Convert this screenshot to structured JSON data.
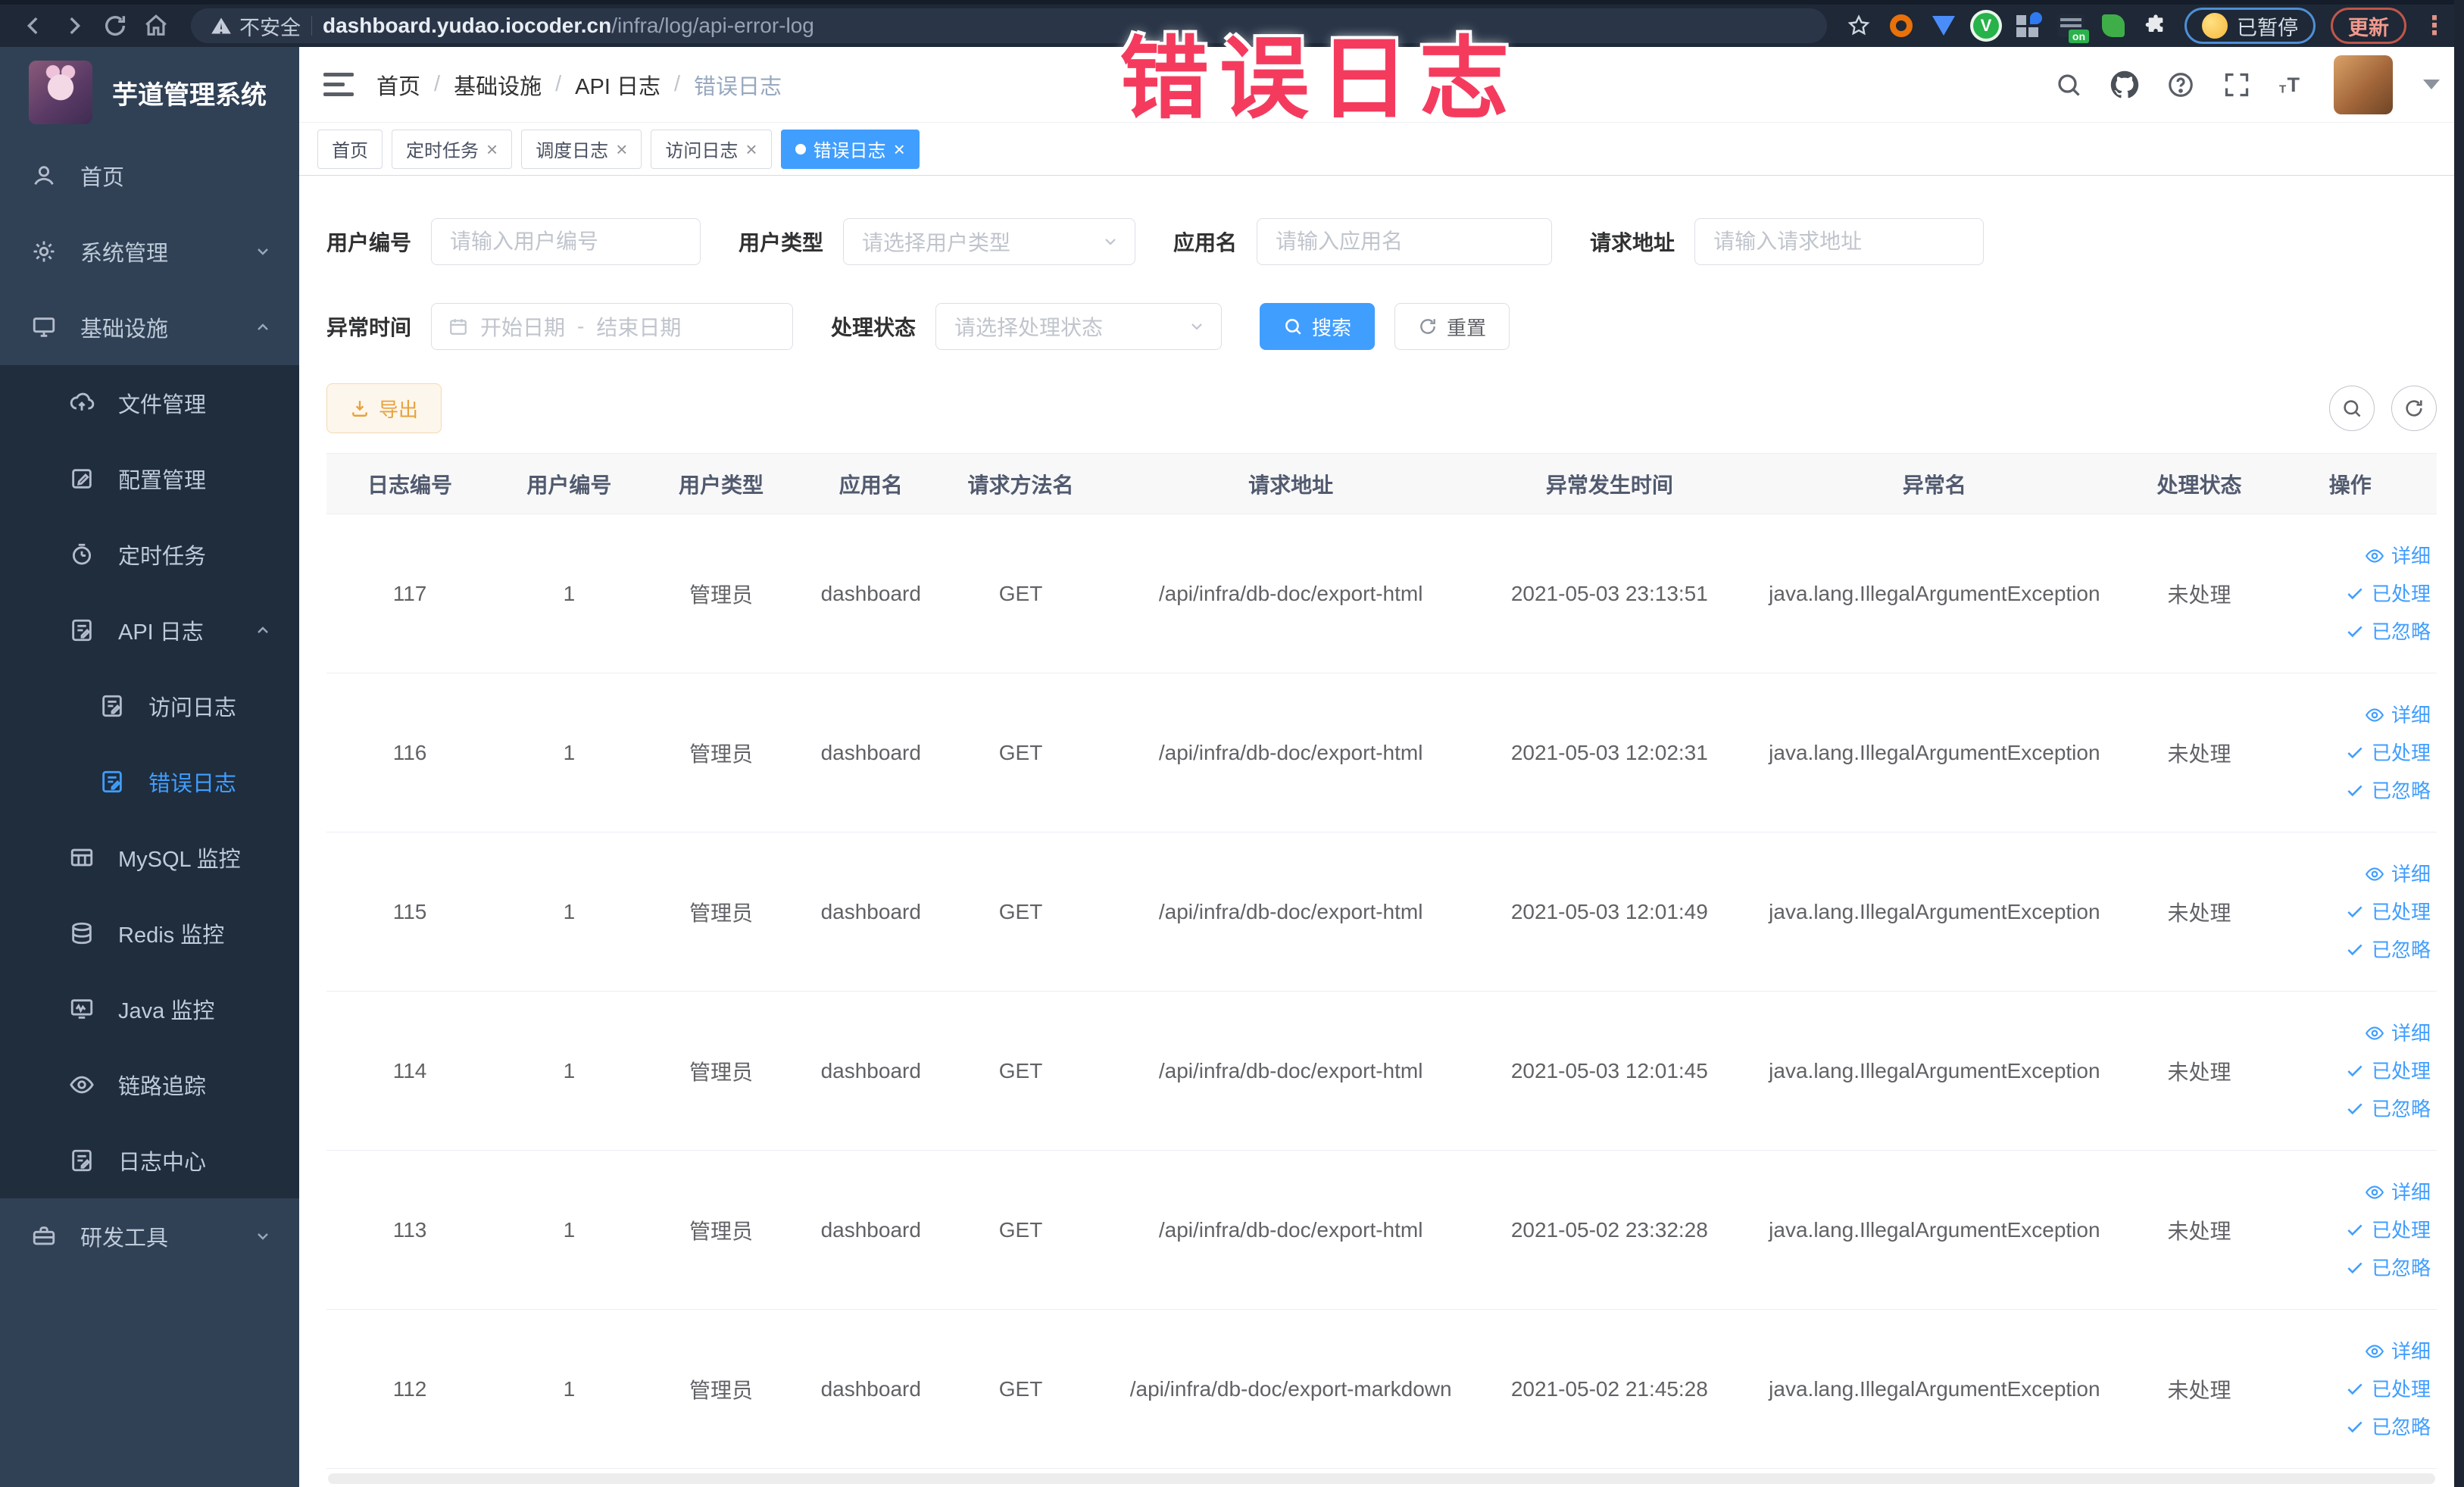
{
  "browser": {
    "security_label": "不安全",
    "url_host": "dashboard.yudao.iocoder.cn",
    "url_path": "/infra/log/api-error-log",
    "paused_badge": "已暂停",
    "update_badge": "更新"
  },
  "annotation": {
    "text": "错误日志",
    "color": "#f43b5e"
  },
  "sidebar": {
    "title": "芋道管理系统",
    "items": [
      {
        "label": "首页"
      },
      {
        "label": "系统管理"
      },
      {
        "label": "基础设施"
      },
      {
        "label": "文件管理"
      },
      {
        "label": "配置管理"
      },
      {
        "label": "定时任务"
      },
      {
        "label": "API 日志"
      },
      {
        "label": "访问日志"
      },
      {
        "label": "错误日志"
      },
      {
        "label": "MySQL 监控"
      },
      {
        "label": "Redis 监控"
      },
      {
        "label": "Java 监控"
      },
      {
        "label": "链路追踪"
      },
      {
        "label": "日志中心"
      },
      {
        "label": "研发工具"
      }
    ]
  },
  "breadcrumb": {
    "items": [
      "首页",
      "基础设施",
      "API 日志",
      "错误日志"
    ]
  },
  "tabs": [
    {
      "label": "首页"
    },
    {
      "label": "定时任务"
    },
    {
      "label": "调度日志"
    },
    {
      "label": "访问日志"
    },
    {
      "label": "错误日志"
    }
  ],
  "filters": {
    "user_id_label": "用户编号",
    "user_id_placeholder": "请输入用户编号",
    "user_type_label": "用户类型",
    "user_type_placeholder": "请选择用户类型",
    "app_label": "应用名",
    "app_placeholder": "请输入应用名",
    "req_url_label": "请求地址",
    "req_url_placeholder": "请输入请求地址",
    "time_label": "异常时间",
    "time_start_placeholder": "开始日期",
    "time_separator": "-",
    "time_end_placeholder": "结束日期",
    "status_label": "处理状态",
    "status_placeholder": "请选择处理状态",
    "search_label": "搜索",
    "reset_label": "重置"
  },
  "toolbar": {
    "export_label": "导出"
  },
  "table": {
    "headers": [
      "日志编号",
      "用户编号",
      "用户类型",
      "应用名",
      "请求方法名",
      "请求地址",
      "异常发生时间",
      "异常名",
      "处理状态",
      "操作"
    ],
    "action_labels": {
      "detail": "详细",
      "processed": "已处理",
      "ignored": "已忽略"
    },
    "rows": [
      {
        "id": "117",
        "user_id": "1",
        "user_type": "管理员",
        "app": "dashboard",
        "method": "GET",
        "url": "/api/infra/db-doc/export-html",
        "time": "2021-05-03 23:13:51",
        "exception": "java.lang.IllegalArgumentException",
        "status": "未处理"
      },
      {
        "id": "116",
        "user_id": "1",
        "user_type": "管理员",
        "app": "dashboard",
        "method": "GET",
        "url": "/api/infra/db-doc/export-html",
        "time": "2021-05-03 12:02:31",
        "exception": "java.lang.IllegalArgumentException",
        "status": "未处理"
      },
      {
        "id": "115",
        "user_id": "1",
        "user_type": "管理员",
        "app": "dashboard",
        "method": "GET",
        "url": "/api/infra/db-doc/export-html",
        "time": "2021-05-03 12:01:49",
        "exception": "java.lang.IllegalArgumentException",
        "status": "未处理"
      },
      {
        "id": "114",
        "user_id": "1",
        "user_type": "管理员",
        "app": "dashboard",
        "method": "GET",
        "url": "/api/infra/db-doc/export-html",
        "time": "2021-05-03 12:01:45",
        "exception": "java.lang.IllegalArgumentException",
        "status": "未处理"
      },
      {
        "id": "113",
        "user_id": "1",
        "user_type": "管理员",
        "app": "dashboard",
        "method": "GET",
        "url": "/api/infra/db-doc/export-html",
        "time": "2021-05-02 23:32:28",
        "exception": "java.lang.IllegalArgumentException",
        "status": "未处理"
      },
      {
        "id": "112",
        "user_id": "1",
        "user_type": "管理员",
        "app": "dashboard",
        "method": "GET",
        "url": "/api/infra/db-doc/export-markdown",
        "time": "2021-05-02 21:45:28",
        "exception": "java.lang.IllegalArgumentException",
        "status": "未处理"
      }
    ]
  },
  "icons": {
    "close": "×",
    "kebab": "⋮",
    "accent_blue": "#409eff",
    "warn_orange": "#e6a23c",
    "annotation_red": "#f43b5e"
  }
}
